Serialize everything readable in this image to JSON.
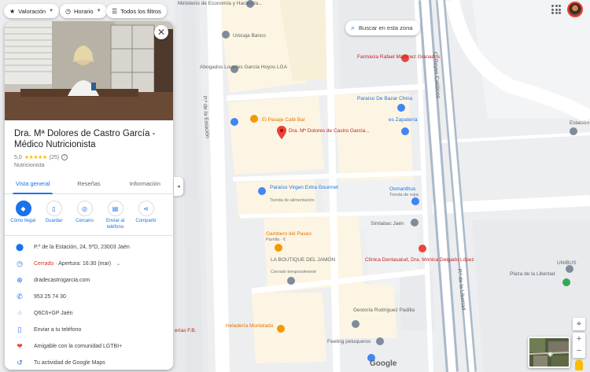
{
  "top_chips": [
    {
      "label": "Valoración"
    },
    {
      "label": "Horario"
    },
    {
      "label": "Todos los filtros"
    }
  ],
  "search_area": "Buscar en esta zona",
  "place": {
    "title": "Dra. Mª Dolores de Castro García - Médico Nutricionista",
    "rating": "5,0",
    "stars": "★★★★★",
    "reviews": "(25)",
    "category": "Nutricionista"
  },
  "tabs": [
    "Vista general",
    "Reseñas",
    "Información"
  ],
  "actions": [
    {
      "label": "Cómo llegar"
    },
    {
      "label": "Guardar"
    },
    {
      "label": "Cercano"
    },
    {
      "label": "Enviar al teléfono"
    },
    {
      "label": "Compartir"
    }
  ],
  "info": {
    "address": "P.º de la Estación, 24, 5ºD, 23003 Jaén",
    "hours_status": "Cerrado",
    "hours_detail": " · Apertura: 16:30 (mar)",
    "website": "dradecastrogarcia.com",
    "phone": "953 25 74 30",
    "plus_code": "Q6C6+GP Jaén",
    "send": "Enviar a tu teléfono",
    "lgbtq": "Amigable con la comunidad LGTBI+",
    "activity": "Tu actividad de Google Maps"
  },
  "map_labels": {
    "ministerio": "Ministerio de Economía y Hacienda...",
    "unicaja": "Unicaja Banco",
    "abogados": "Abogados Lourdes García Hoyos LGA",
    "farmacia": "Farmacia Rafael Martínez Granados",
    "paraiso_bazar": "Paraíso De Bazar China",
    "es_zapateria": "es Zapatería",
    "pasaje": "El Pasaje Café Bar",
    "selected_place": "Dra. Mª Dolores de Castro García...",
    "paraiso_virgen": "Paraíso Virgen Extra Gourmet",
    "paraiso_virgen_sub": "Tienda de alimentación",
    "osmanthus": "Osmanthus",
    "osmanthus_sub": "Tienda de ropa",
    "simlabac": "Simlabac Jaén",
    "gambero": "Gambero del Paseo",
    "gambero_sub": "Parrilla · €",
    "boutique": "LA BOUTIQUE DEL JAMÓN",
    "boutique_sub": "Cerrado temporalmente",
    "clinica": "Clínica Dentasalud, Dra. Mónica Delgado López",
    "gestoria": "Gestoría Rodríguez Padilla",
    "heladeria": "Heladería Montelado",
    "feeling": "Feeling peluqueros",
    "unibus": "UNIBUS",
    "plaza_libertad": "Plaza de la Libertad",
    "estacion": "Estación",
    "street_estacion": "P.º de la Estación",
    "street_reyes": "C. Reyes Católicos",
    "street_libertad": "P.º de la Libertad",
    "partial_left": "erías F.B."
  },
  "google_logo": "Google",
  "colors": {
    "accent": "#1a73e8",
    "closed": "#d93025",
    "pin": "#ea4335",
    "food": "#f29900",
    "shop": "#4285f4",
    "health": "#e8453c",
    "block": "#fdf5e3",
    "street": "#ffffff",
    "road": "#aab9c9"
  }
}
